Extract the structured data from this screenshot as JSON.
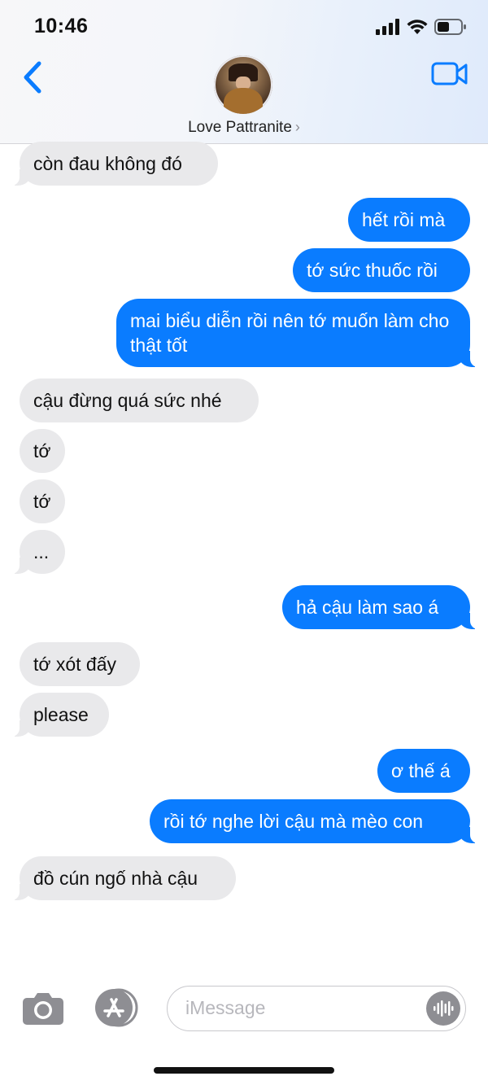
{
  "status": {
    "time": "10:46"
  },
  "header": {
    "contact_name": "Love Pattranite",
    "chevron": "›"
  },
  "messages": [
    {
      "text": "còn đau không đó"
    },
    {
      "text": "hết rồi mà"
    },
    {
      "text": "tớ sức thuốc rồi"
    },
    {
      "text": "mai biểu diễn rồi nên tớ muốn làm cho thật tốt"
    },
    {
      "text": "cậu đừng quá sức nhé"
    },
    {
      "text": "tớ"
    },
    {
      "text": "tớ"
    },
    {
      "text": "..."
    },
    {
      "text": "hả cậu làm sao á"
    },
    {
      "text": "tớ xót đấy"
    },
    {
      "text": "please"
    },
    {
      "text": "ơ thế á"
    },
    {
      "text": "rồi tớ nghe lời cậu mà mèo con"
    },
    {
      "text": "đồ cún ngố nhà cậu"
    }
  ],
  "composer": {
    "placeholder": "iMessage"
  },
  "colors": {
    "outgoing": "#0a7cff",
    "incoming": "#e9e9eb",
    "accent": "#0a7cff"
  },
  "icons": [
    "back-chevron-icon",
    "video-call-icon",
    "camera-icon",
    "app-store-icon",
    "audio-message-icon",
    "signal-icon",
    "wifi-icon",
    "battery-icon"
  ]
}
